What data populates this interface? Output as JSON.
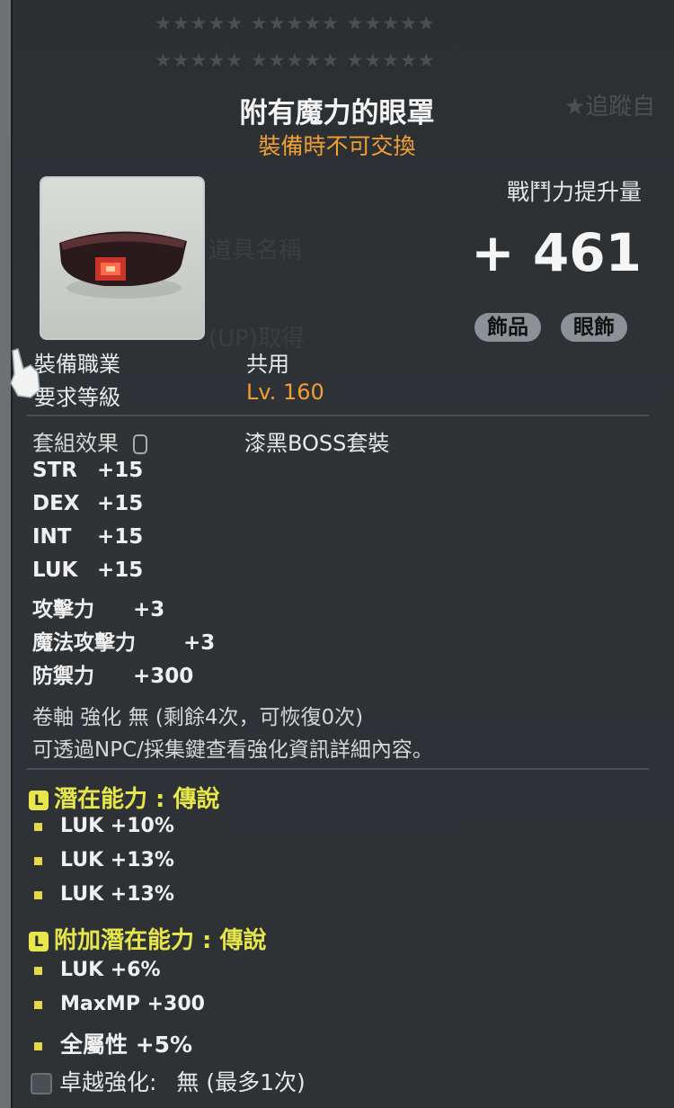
{
  "header": {
    "star_rows": [
      "★★★★★ ★★★★★ ★★★★★",
      "★★★★★ ★★★★★ ★★★★★"
    ],
    "track_label": "★追蹤自",
    "ghost_texts": [
      "道具名稱",
      "(UP)取得"
    ]
  },
  "item": {
    "name": "附有魔力的眼罩",
    "trade_note": "裝備時不可交換",
    "icon": "enchanted-eyepatch-icon",
    "combat_power_label": "戰鬥力提升量",
    "combat_power_value": "+ 461",
    "tags": [
      "飾品",
      "眼飾"
    ]
  },
  "requirements": [
    {
      "label": "裝備職業",
      "value": "共用"
    },
    {
      "label": "要求等級",
      "value": "Lv. 160"
    }
  ],
  "set_effect": {
    "label": "套組效果",
    "value": "漆黑BOSS套裝"
  },
  "stats": [
    {
      "name": "STR",
      "value": "+15"
    },
    {
      "name": "DEX",
      "value": "+15"
    },
    {
      "name": "INT",
      "value": "+15"
    },
    {
      "name": "LUK",
      "value": "+15"
    },
    {
      "name": "攻擊力",
      "value": "+3"
    },
    {
      "name": "魔法攻擊力",
      "value": "+3"
    },
    {
      "name": "防禦力",
      "value": "+300"
    }
  ],
  "scroll": {
    "line1": "卷軸 強化 無 (剩餘4次，可恢復0次)",
    "line2": "可透過NPC/採集鍵查看強化資訊詳細內容。"
  },
  "potential": {
    "badge": "L",
    "title": "潛在能力 : 傳說",
    "lines": [
      "LUK +10%",
      "LUK +13%",
      "LUK +13%"
    ]
  },
  "additional_potential": {
    "badge": "L",
    "title": "附加潛在能力 : 傳說",
    "lines": [
      "LUK +6%",
      "MaxMP +300",
      "全屬性 +5%"
    ]
  },
  "exceptional": {
    "label": "卓越強化:",
    "value": "無 (最多1次)"
  },
  "colors": {
    "orange": "#f0a032",
    "potential_yellow": "#e6e64a",
    "panel": "#2e3235"
  }
}
